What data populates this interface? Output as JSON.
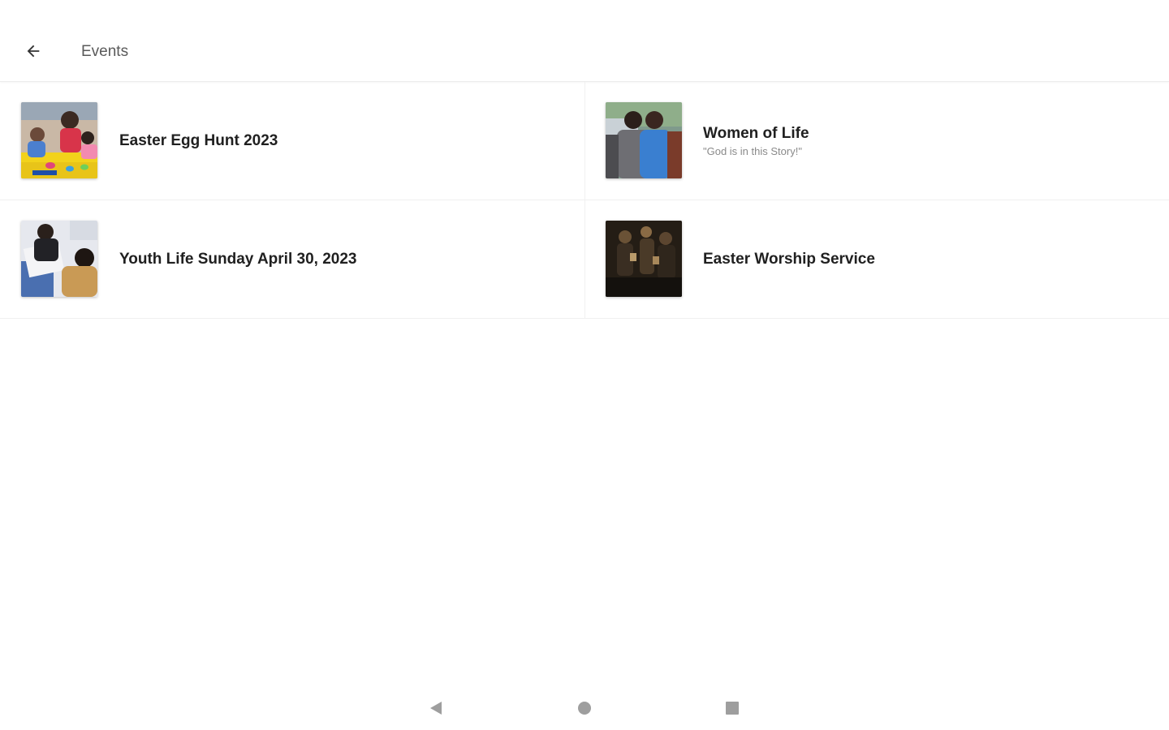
{
  "appbar": {
    "title": "Events",
    "back_icon": "arrow-back-icon"
  },
  "events": [
    {
      "title": "Easter Egg Hunt 2023",
      "subtitle": "",
      "image": "easter-egg-hunt-photo"
    },
    {
      "title": "Women of Life",
      "subtitle": "\"God is in this Story!\"",
      "image": "women-of-life-photo"
    },
    {
      "title": "Youth Life Sunday April 30, 2023",
      "subtitle": "",
      "image": "youth-life-sunday-photo"
    },
    {
      "title": "Easter Worship Service",
      "subtitle": "",
      "image": "easter-worship-photo"
    }
  ],
  "navbar": {
    "back_icon": "nav-back-triangle-icon",
    "home_icon": "nav-home-circle-icon",
    "recents_icon": "nav-recents-square-icon"
  },
  "colors": {
    "text_primary": "#202020",
    "text_secondary": "#8a8a8a",
    "divider": "#f0f0f0",
    "nav_icon": "#9e9e9e"
  }
}
